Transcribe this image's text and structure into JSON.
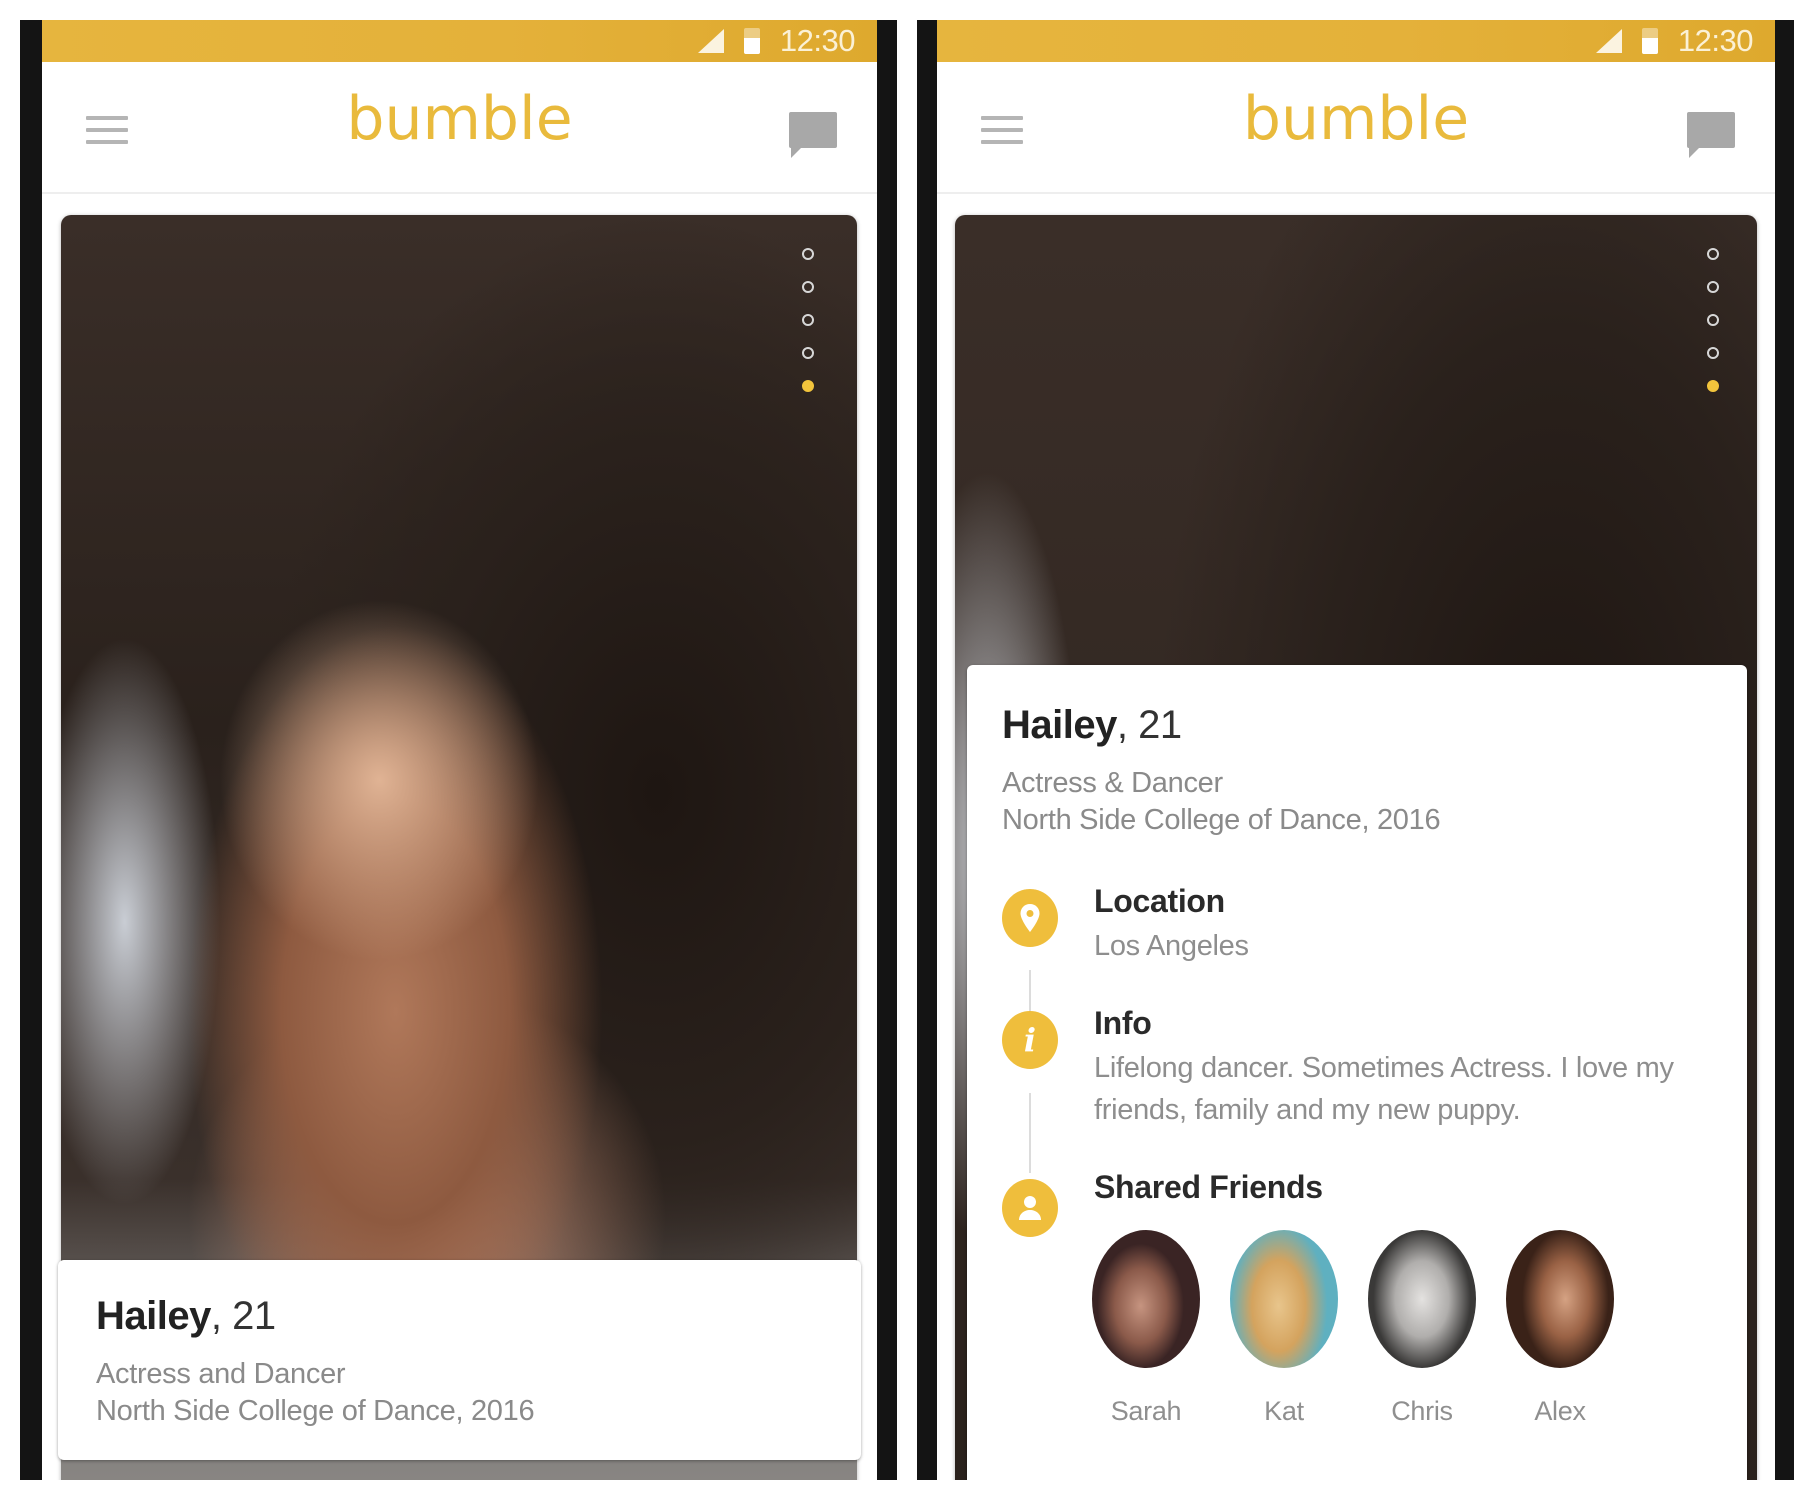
{
  "status_bar": {
    "time": "12:30",
    "signal_icon": "signal-icon",
    "battery_icon": "battery-icon"
  },
  "app_bar": {
    "logo": "bumble",
    "menu_icon": "hamburger-menu-icon",
    "chat_icon": "chat-bubble-icon"
  },
  "colors": {
    "brand_yellow": "#e9ba3c",
    "status_bar": "#e4b13a",
    "active_dot": "#f2c43c"
  },
  "photo_pager": {
    "total": 5,
    "active_index": 4
  },
  "left_screen": {
    "profile": {
      "name": "Hailey",
      "age": ", 21",
      "occupation": "Actress and Dancer",
      "education": "North Side College of Dance, 2016"
    }
  },
  "right_screen": {
    "profile": {
      "name": "Hailey",
      "age": ", 21",
      "occupation": "Actress & Dancer",
      "education": "North Side College of Dance, 2016"
    },
    "sections": {
      "location": {
        "title": "Location",
        "value": "Los Angeles",
        "icon": "location-pin-icon"
      },
      "info": {
        "title": "Info",
        "value": "Lifelong dancer. Sometimes Actress. I love my friends, family and my new puppy.",
        "icon": "info-icon"
      },
      "shared_friends": {
        "title": "Shared Friends",
        "icon": "person-icon"
      }
    },
    "friends": [
      {
        "name": "Sarah"
      },
      {
        "name": "Kat"
      },
      {
        "name": "Chris"
      },
      {
        "name": "Alex"
      }
    ]
  }
}
